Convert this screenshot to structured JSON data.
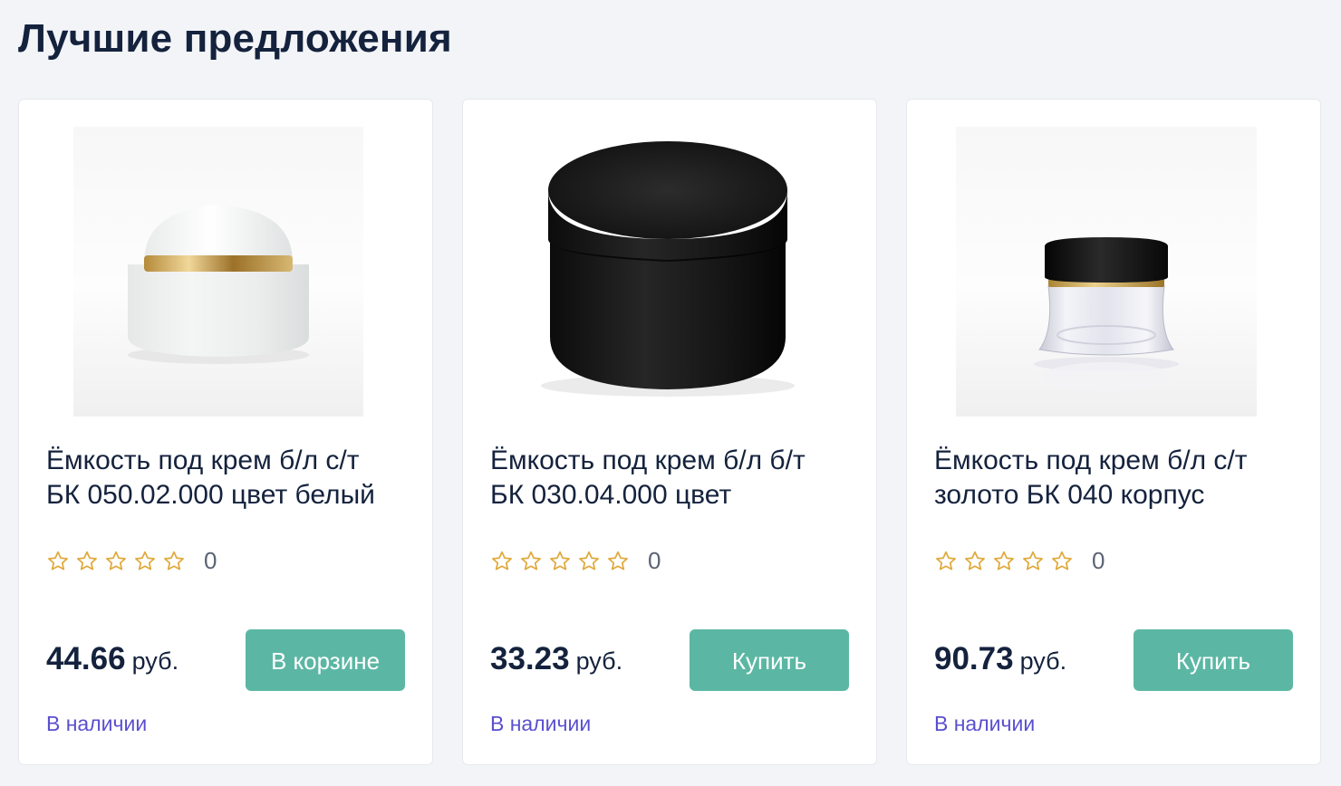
{
  "section": {
    "title": "Лучшие предложения"
  },
  "products": [
    {
      "name_line1": "Ёмкость под крем б/л с/т",
      "name_line2": "БК 050.02.000 цвет белый",
      "rating_count": "0",
      "price": "44.66",
      "currency": "руб.",
      "button_label": "В корзине",
      "stock": "В наличии",
      "image_icon": "white-cream-jar-icon"
    },
    {
      "name_line1": "Ёмкость под крем б/л б/т",
      "name_line2": "БК 030.04.000 цвет",
      "rating_count": "0",
      "price": "33.23",
      "currency": "руб.",
      "button_label": "Купить",
      "stock": "В наличии",
      "image_icon": "black-cream-jar-icon"
    },
    {
      "name_line1": "Ёмкость под крем б/л с/т",
      "name_line2": "золото БК 040 корпус",
      "rating_count": "0",
      "price": "90.73",
      "currency": "руб.",
      "button_label": "Купить",
      "stock": "В наличии",
      "image_icon": "clear-cream-jar-icon"
    }
  ],
  "colors": {
    "accent_button": "#5bb7a4",
    "stock_text": "#5a4fcf",
    "star_outline": "#e0a93b",
    "title_text": "#14223d"
  }
}
